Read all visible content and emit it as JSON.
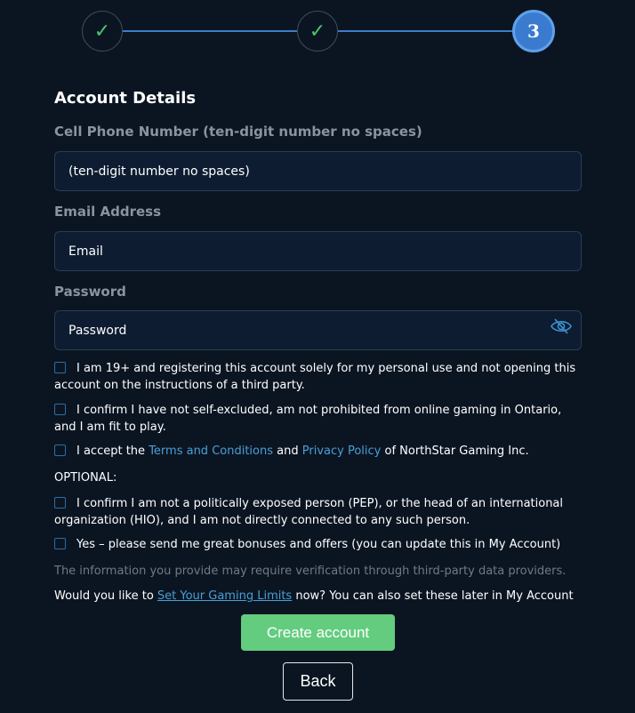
{
  "stepper": {
    "steps": [
      {
        "state": "complete",
        "icon": "check-icon",
        "glyph": "✓"
      },
      {
        "state": "complete",
        "icon": "check-icon",
        "glyph": "✓"
      },
      {
        "state": "active",
        "number": "3"
      }
    ],
    "colors": {
      "line": "#3d7cc9",
      "check": "#4ec46e",
      "active": "#3a7bd0"
    }
  },
  "form": {
    "title": "Account Details",
    "phone": {
      "label": "Cell Phone Number (ten-digit number no spaces)",
      "placeholder": "(ten-digit number no spaces)",
      "value": ""
    },
    "email": {
      "label": "Email Address",
      "placeholder": "Email",
      "value": ""
    },
    "password": {
      "label": "Password",
      "placeholder": "Password",
      "value": "",
      "toggle_icon": "eye-slash-icon"
    },
    "checkboxes": [
      {
        "text": "I am 19+ and registering this account solely for my personal use and not opening this account on the instructions of a third party.",
        "checked": false
      },
      {
        "text": "I confirm I have not self-excluded, am not prohibited from online gaming in Ontario, and I am fit to play.",
        "checked": false
      },
      {
        "prefix": "I accept the ",
        "link1": "Terms and Conditions",
        "middle": " and ",
        "link2": "Privacy Policy",
        "suffix": " of NorthStar Gaming Inc.",
        "checked": false
      }
    ],
    "optional_label": "OPTIONAL:",
    "optional_checkboxes": [
      {
        "text": "I confirm I am not a politically exposed person (PEP), or the head of an international organization (HIO), and I am not directly connected to any such person.",
        "checked": false
      },
      {
        "text": "Yes – please send me great bonuses and offers (you can update this in My Account)",
        "checked": false
      }
    ],
    "verification_note": "The information you provide may require verification through third-party data providers.",
    "limits": {
      "prefix": "Would you like to ",
      "link": "Set Your Gaming Limits",
      "suffix": " now? You can also set these later in My Account"
    }
  },
  "buttons": {
    "create": "Create account",
    "back": "Back"
  },
  "colors": {
    "background": "#0b1522",
    "primary_button": "#63cc7f",
    "link": "#4a9fd6"
  }
}
